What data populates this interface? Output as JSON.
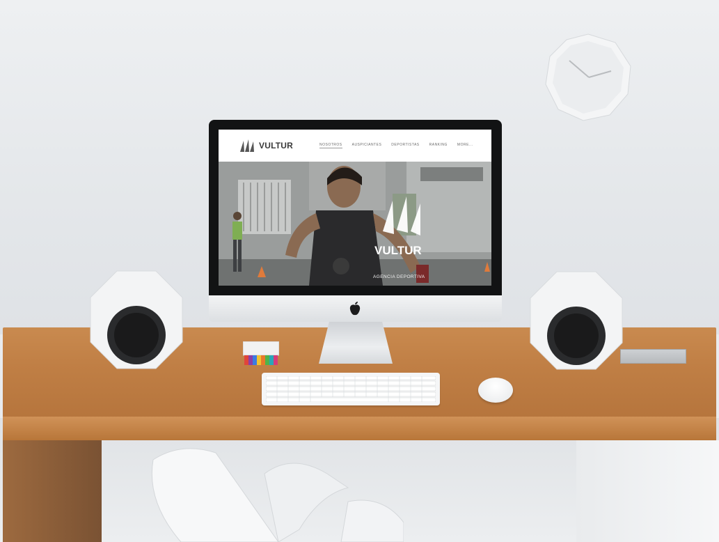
{
  "site": {
    "brand": {
      "name": "VULTUR",
      "icon": "claw-marks-logo-icon"
    },
    "nav": [
      {
        "label": "NOSOTROS",
        "active": true
      },
      {
        "label": "AUSPICIANTES",
        "active": false
      },
      {
        "label": "DEPORTISTAS",
        "active": false
      },
      {
        "label": "RANKING",
        "active": false
      },
      {
        "label": "MORE...",
        "active": false
      }
    ],
    "hero": {
      "title": "VULTUR",
      "subtitle": "AGENCIA DEPORTIVA",
      "logo_icon": "claw-marks-logo-icon"
    }
  },
  "scene_icons": [
    "apple-logo-icon",
    "clock-icon"
  ],
  "colors": {
    "wood": "#c07f45",
    "bezel": "#121314",
    "wall": "#e9ebee"
  }
}
